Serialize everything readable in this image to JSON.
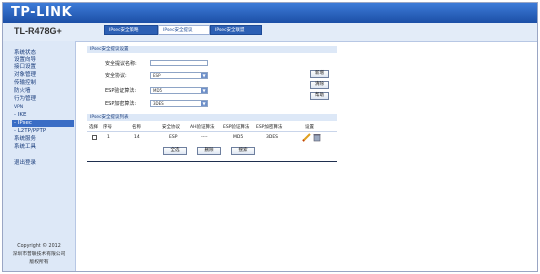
{
  "header": {
    "logo": "TP-LINK",
    "model": "TL-R478G+"
  },
  "tabs": [
    {
      "label": "IPsec安全策略",
      "active": false
    },
    {
      "label": "IPsec安全提议",
      "active": true
    },
    {
      "label": "IPsec安全联盟",
      "active": false
    }
  ],
  "sidebar": {
    "items": [
      "系统状态",
      "设置向导",
      "接口设置",
      "对象管理",
      "传输控制",
      "防火墙",
      "行为管理",
      "VPN",
      "- IKE",
      "- IPsec",
      "- L2TP/PPTP",
      "系统服务",
      "系统工具",
      "",
      "退出登录"
    ],
    "selected_index": 9
  },
  "copyright": {
    "line1": "Copyright © 2012",
    "line2": "深圳市普联技术有限公司",
    "line3": "版权所有"
  },
  "form": {
    "title": "IPsec安全提议设置",
    "name_label": "安全提议名称:",
    "name_value": "",
    "protocol_label": "安全协议:",
    "protocol_value": "ESP",
    "auth_label": "ESP验证算法:",
    "auth_value": "MD5",
    "enc_label": "ESP加密算法:",
    "enc_value": "3DES",
    "buttons": {
      "add": "新增",
      "clear": "清除",
      "help": "帮助"
    }
  },
  "list": {
    "title": "IPsec安全提议列表",
    "columns": [
      "选择",
      "序号",
      "名称",
      "安全协议",
      "AH验证算法",
      "ESP验证算法",
      "ESP加密算法",
      "设置"
    ],
    "rows": [
      {
        "index": "1",
        "name": "14",
        "protocol": "ESP",
        "ah_auth": "----",
        "esp_auth": "MD5",
        "esp_enc": "3DES"
      }
    ],
    "buttons": {
      "select_all": "全选",
      "delete": "删除",
      "search": "搜索"
    }
  }
}
